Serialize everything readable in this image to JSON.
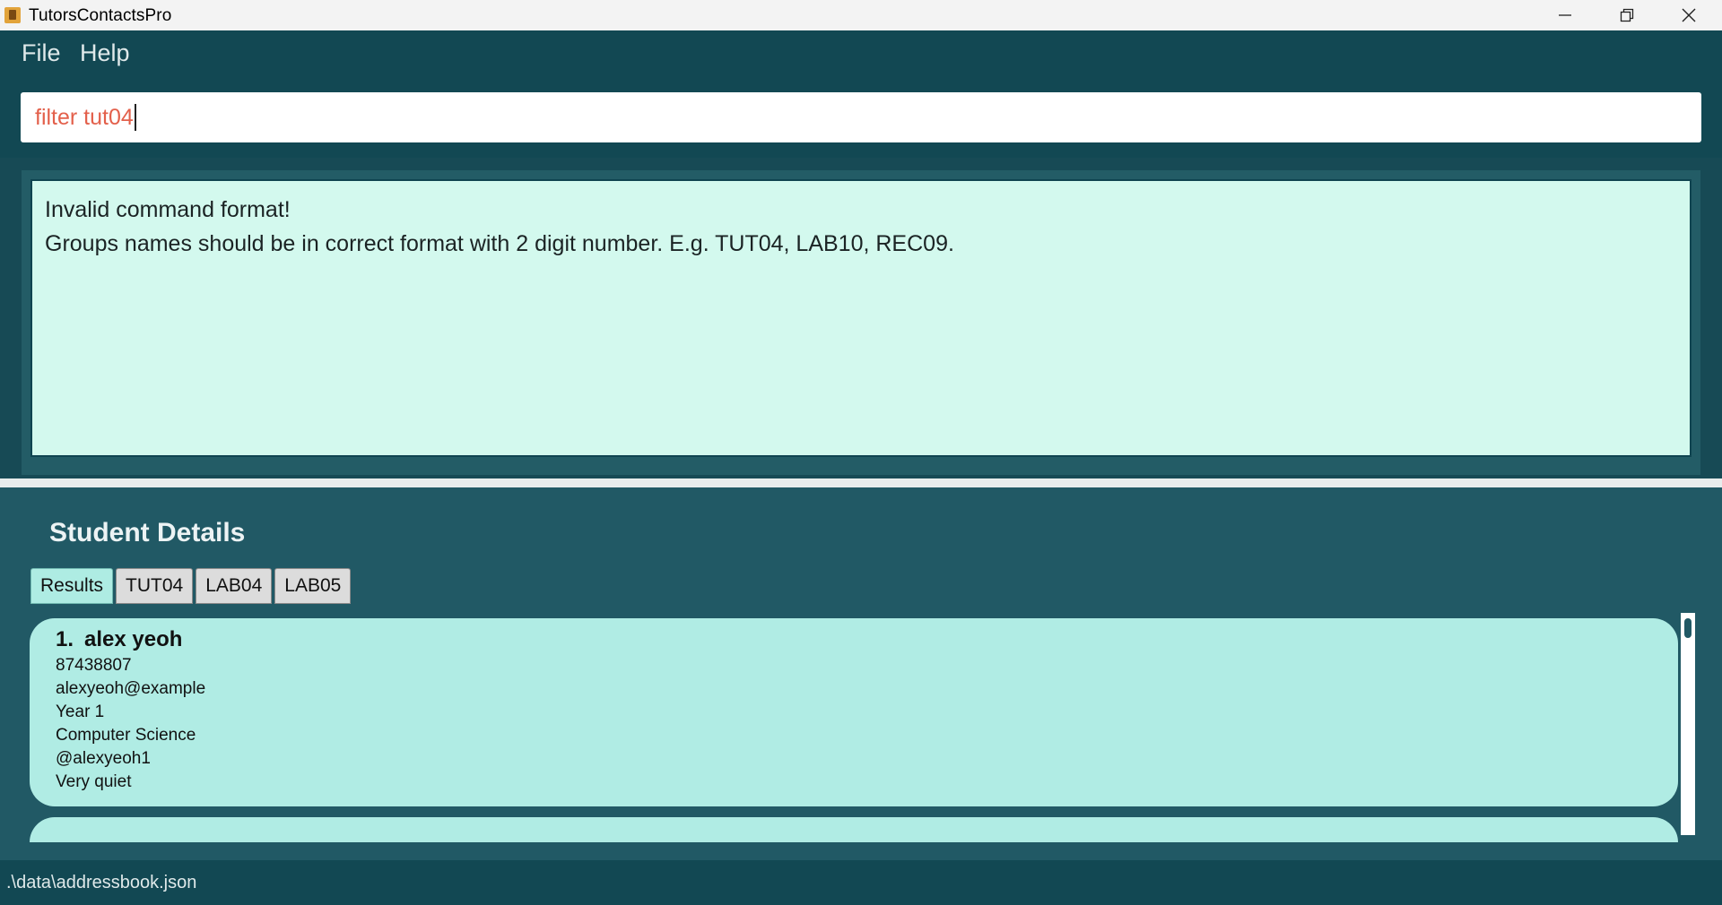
{
  "window": {
    "title": "TutorsContactsPro",
    "controls": [
      "minimize-icon",
      "restore-icon",
      "close-icon"
    ]
  },
  "menu": {
    "items": [
      "File",
      "Help"
    ]
  },
  "command": {
    "value": "filter tut04"
  },
  "result": {
    "lines": [
      "Invalid command format!",
      "Groups names should be in correct format with 2 digit number. E.g. TUT04, LAB10, REC09."
    ]
  },
  "details": {
    "title": "Student Details",
    "tabs": [
      "Results",
      "TUT04",
      "LAB04",
      "LAB05"
    ],
    "active_tab": "Results",
    "students": [
      {
        "index": "1.",
        "name": "alex yeoh",
        "phone": "87438807",
        "email": "alexyeoh@example",
        "year": "Year 1",
        "major": "Computer Science",
        "telegram": "@alexyeoh1",
        "remark": "Very quiet"
      }
    ]
  },
  "status": {
    "file_path": ".\\data\\addressbook.json"
  },
  "colors": {
    "background": "#1d4e58",
    "command_text": "#e3604b",
    "result_box": "#d3f9ee",
    "card": "#b0ece4",
    "active_tab": "#aeece3"
  }
}
